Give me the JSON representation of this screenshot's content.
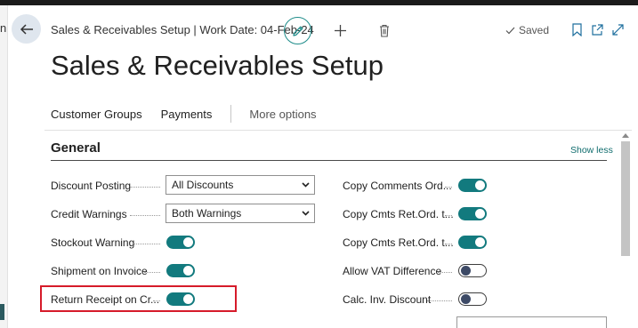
{
  "sidebar": {
    "edge_text": "n"
  },
  "header": {
    "title": "Sales & Receivables Setup | Work Date: 04-Feb-24",
    "saved_label": "Saved"
  },
  "page": {
    "title": "Sales & Receivables Setup"
  },
  "actions": {
    "customer_groups": "Customer Groups",
    "payments": "Payments",
    "more_options": "More options"
  },
  "section": {
    "title": "General",
    "show_less": "Show less"
  },
  "fields_left": {
    "discount_posting": {
      "label": "Discount Posting",
      "value": "All Discounts"
    },
    "credit_warnings": {
      "label": "Credit Warnings",
      "value": "Both Warnings"
    },
    "stockout_warning": {
      "label": "Stockout Warning",
      "on": true
    },
    "shipment_on_invoice": {
      "label": "Shipment on Invoice",
      "on": true
    },
    "return_receipt": {
      "label": "Return Receipt on Cr...",
      "on": true
    }
  },
  "fields_right": {
    "copy_comments": {
      "label": "Copy Comments Ord...",
      "on": true
    },
    "copy_cmts_ret_1": {
      "label": "Copy Cmts Ret.Ord. t...",
      "on": true
    },
    "copy_cmts_ret_2": {
      "label": "Copy Cmts Ret.Ord. t...",
      "on": true
    },
    "allow_vat_diff": {
      "label": "Allow VAT Difference",
      "on": false
    },
    "calc_inv_discount": {
      "label": "Calc. Inv. Discount",
      "on": false
    }
  },
  "colors": {
    "accent": "#127a7e",
    "highlight": "#d61b2a",
    "link": "#0f6c6d"
  },
  "icons": [
    "back-arrow-icon",
    "pencil-icon",
    "plus-icon",
    "trash-icon",
    "checkmark-icon",
    "bookmark-icon",
    "open-new-window-icon",
    "expand-icon",
    "chevron-down-icon"
  ]
}
